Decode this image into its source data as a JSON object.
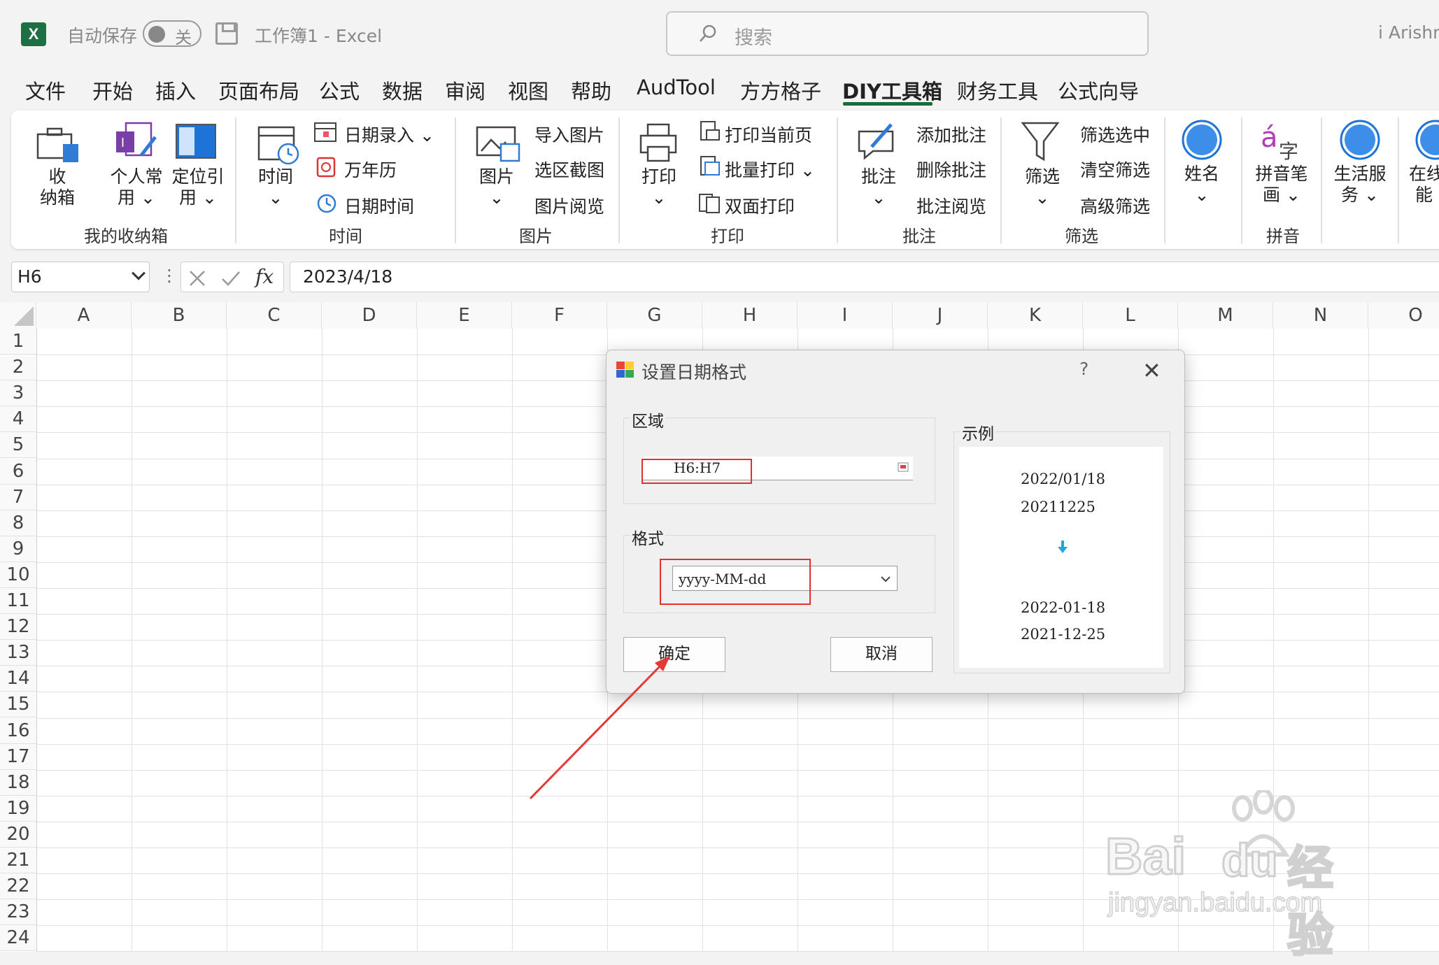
{
  "titlebar": {
    "app_icon": "X",
    "autosave_label": "自动保存",
    "toggle_text": "关",
    "doc_title": "工作簿1  -  Excel",
    "search_placeholder": "搜索",
    "user": "i Arishm"
  },
  "menu": {
    "tabs": [
      "文件",
      "开始",
      "插入",
      "页面布局",
      "公式",
      "数据",
      "审阅",
      "视图",
      "帮助",
      "AudTool",
      "方方格子",
      "DIY工具箱",
      "财务工具",
      "公式向导"
    ],
    "active": "DIY工具箱"
  },
  "ribbon": {
    "g1": {
      "name": "我的收纳箱",
      "btn1": "收\n纳箱",
      "btn2": "个人常\n用 ⌄",
      "btn3": "定位引\n用 ⌄"
    },
    "g2": {
      "name": "时间",
      "big": "时间\n⌄",
      "items": [
        "日期录入  ⌄",
        "万年历",
        "日期时间"
      ]
    },
    "g3": {
      "name": "图片",
      "big": "图片\n⌄",
      "items": [
        "导入图片",
        "选区截图",
        "图片阅览"
      ]
    },
    "g4": {
      "name": "打印",
      "big": "打印\n⌄",
      "items": [
        "打印当前页",
        "批量打印  ⌄",
        "双面打印"
      ]
    },
    "g5": {
      "name": "批注",
      "big": "批注\n⌄",
      "items": [
        "添加批注",
        "删除批注",
        "批注阅览"
      ]
    },
    "g6": {
      "name": "筛选",
      "big": "筛选\n⌄",
      "items": [
        "筛选选中",
        "清空筛选",
        "高级筛选"
      ]
    },
    "g7": {
      "big": "姓名\n⌄"
    },
    "g8": {
      "name": "拼音",
      "big": "拼音笔\n画 ⌄"
    },
    "g9": {
      "big": "生活服\n务 ⌄"
    },
    "g10": {
      "big": "在线\n能"
    }
  },
  "formula_bar": {
    "name_box": "H6",
    "fx": "fx",
    "value": "2023/4/18"
  },
  "grid": {
    "columns": [
      "A",
      "B",
      "C",
      "D",
      "E",
      "F",
      "G",
      "H",
      "I",
      "J",
      "K",
      "L",
      "M",
      "N",
      "O"
    ],
    "rows": [
      "1",
      "2",
      "3",
      "4",
      "5",
      "6",
      "7",
      "8",
      "9",
      "10",
      "11",
      "12",
      "13",
      "14",
      "15",
      "16",
      "17",
      "18",
      "19",
      "20",
      "21",
      "22",
      "23",
      "24"
    ]
  },
  "dialog": {
    "title": "设置日期格式",
    "help": "?",
    "close": "✕",
    "region_label": "区域",
    "region_value": "H6:H7",
    "format_label": "格式",
    "format_value": "yyyy-MM-dd",
    "example_label": "示例",
    "example_before": [
      "2022/01/18",
      "20211225"
    ],
    "example_arrow": "🡇",
    "example_after": [
      "2022-01-18",
      "2021-12-25"
    ],
    "ok": "确定",
    "cancel": "取消"
  },
  "watermark": {
    "brand": "Bai",
    "brand2": "du",
    "cn": "经验",
    "url": "jingyan.baidu.com"
  }
}
